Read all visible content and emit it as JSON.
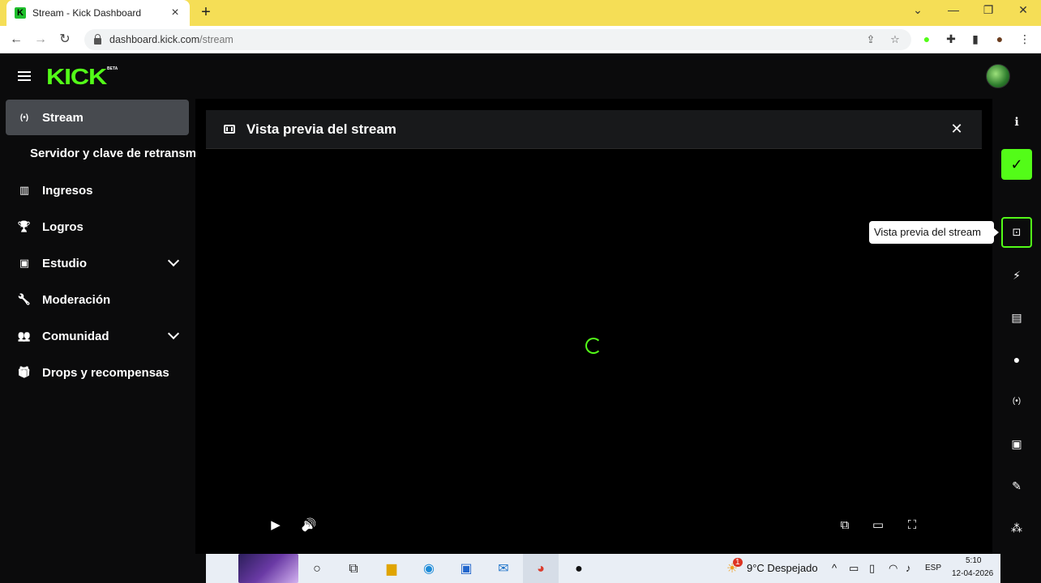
{
  "browser": {
    "tab_title": "Stream - Kick Dashboard",
    "tab_favicon": "K",
    "url_domain": "dashboard.kick.com",
    "url_path": "/stream",
    "colors": {
      "tabbar": "#f5de56"
    }
  },
  "app": {
    "logo": "KICK",
    "logo_badge": "BETA",
    "colors": {
      "accent": "#53fc18",
      "active_item": "#474a4f",
      "background": "#0b0b0c"
    }
  },
  "sidebar": {
    "items": [
      {
        "label": "Stream",
        "icon": "broadcast-icon",
        "glyph": "(•)"
      },
      {
        "label": "Servidor y clave de retransmisión",
        "sub": true
      },
      {
        "label": "Ingresos",
        "icon": "bar-chart-icon",
        "glyph": "▥"
      },
      {
        "label": "Logros",
        "icon": "trophy-icon",
        "glyph": "🏆"
      },
      {
        "label": "Estudio",
        "icon": "studio-icon",
        "glyph": "▣",
        "expandable": true
      },
      {
        "label": "Moderación",
        "icon": "wrench-icon",
        "glyph": "🔧"
      },
      {
        "label": "Comunidad",
        "icon": "people-icon",
        "glyph": "👥",
        "expandable": true
      },
      {
        "label": "Drops y recompensas",
        "icon": "gift-icon",
        "glyph": "🎁"
      }
    ]
  },
  "panel": {
    "title": "Vista previa del stream",
    "close_glyph": "✕"
  },
  "player": {
    "play_glyph": "▶",
    "volume_glyph": "🔊",
    "pip_glyph": "⧉",
    "theater_glyph": "▭",
    "fullscreen_glyph": "⛶"
  },
  "rightbar": {
    "tooltip": "Vista previa del stream",
    "check_glyph": "✓",
    "icons": [
      "info-icon",
      "check-icon",
      "preview-icon",
      "bolt-icon",
      "notes-icon",
      "chat-icon",
      "broadcast-icon",
      "studio-icon",
      "wrench-icon",
      "users-icon"
    ]
  },
  "taskbar": {
    "weather": "9°C  Despejado",
    "weather_badge": "1",
    "language": "ESP",
    "time": "5:10",
    "date": "12-04-2026"
  }
}
